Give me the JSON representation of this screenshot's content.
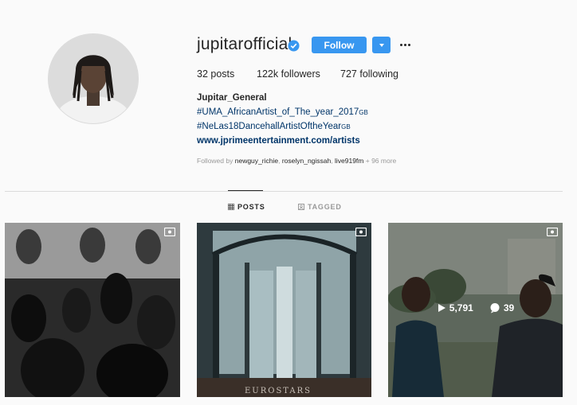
{
  "profile": {
    "username": "jupitarofficial",
    "follow_label": "Follow",
    "stats": {
      "posts_count": "32",
      "posts_label": "posts",
      "followers_count": "122k",
      "followers_label": "followers",
      "following_count": "727",
      "following_label": "following"
    },
    "bio": {
      "name": "Jupitar_General",
      "line1": "#UMA_AfricanArtist_of_The_year_2017",
      "line1_suffix": "GB",
      "line2": "#NeLas18DancehallArtistOftheYear",
      "line2_suffix": "GB",
      "link": "www.jprimeentertainment.com/artists"
    },
    "followed_by": {
      "prefix": "Followed by",
      "user1": "newguy_richie",
      "user2": "roselyn_ngissah",
      "user3": "live919fm",
      "more": "+ 96 more"
    }
  },
  "tabs": [
    {
      "label": "POSTS",
      "active": true
    },
    {
      "label": "TAGGED",
      "active": false
    }
  ],
  "posts": [
    {
      "type": "video",
      "image": "concert crowd black and white"
    },
    {
      "type": "video",
      "image": "revolving door",
      "text": "EUROSTARS"
    },
    {
      "type": "video",
      "image": "two men outdoors",
      "views": "5,791",
      "comments": "39"
    }
  ],
  "colors": {
    "accent": "#3897f0",
    "link": "#003569",
    "muted": "#999999",
    "background": "#fafafa"
  }
}
